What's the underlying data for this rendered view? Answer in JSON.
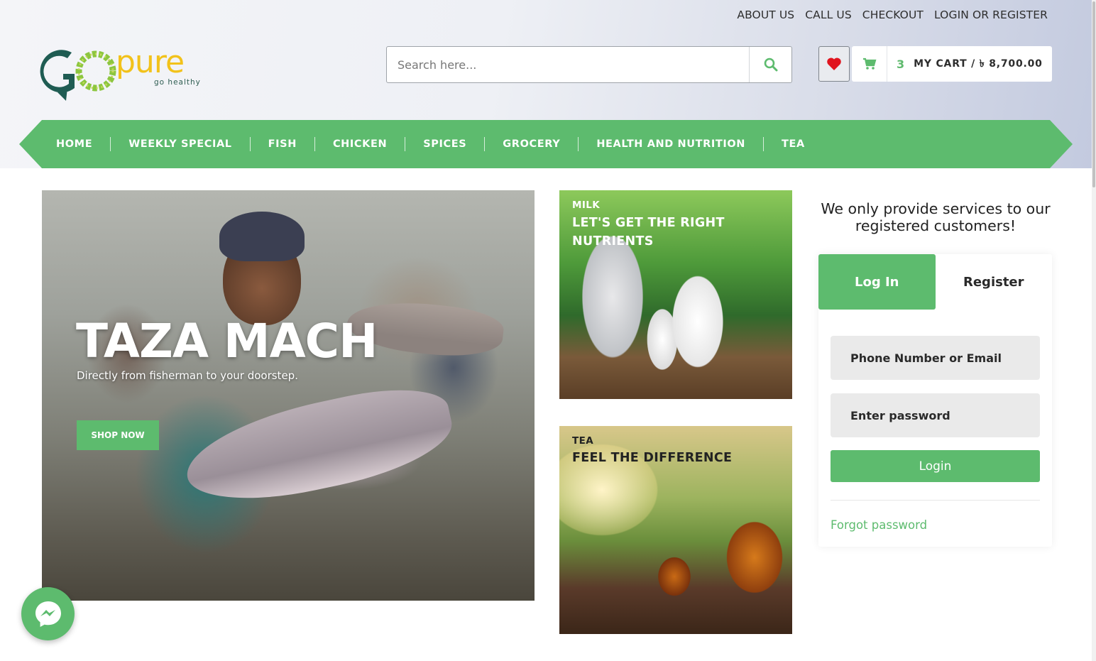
{
  "top_links": [
    "ABOUT US",
    "CALL US",
    "CHECKOUT",
    "LOGIN OR REGISTER"
  ],
  "logo": {
    "pure": "pure",
    "tagline": "go healthy"
  },
  "search": {
    "placeholder": "Search here...",
    "icon": "search-icon"
  },
  "wishlist": {
    "icon": "heart-icon"
  },
  "cart": {
    "icon": "cart-icon",
    "count": "3",
    "label": "MY CART / ৳ 8,700.00"
  },
  "nav": [
    "HOME",
    "WEEKLY SPECIAL",
    "FISH",
    "CHICKEN",
    "SPICES",
    "GROCERY",
    "HEALTH AND NUTRITION",
    "TEA"
  ],
  "hero": {
    "title": "TAZA MACH",
    "subtitle": "Directly from fisherman to your doorstep.",
    "cta": "SHOP NOW"
  },
  "promos": [
    {
      "kicker": "MILK",
      "headline": "LET'S GET THE RIGHT NUTRIENTS"
    },
    {
      "kicker": "TEA",
      "headline": "FEEL THE DIFFERENCE"
    }
  ],
  "auth": {
    "notice": "We only provide services to our registered customers!",
    "tab_login": "Log In",
    "tab_register": "Register",
    "identity_placeholder": "Phone Number or Email",
    "password_placeholder": "Enter password",
    "login_button": "Login",
    "forgot": "Forgot password"
  },
  "messenger": {
    "icon": "messenger-icon"
  },
  "colors": {
    "brand_green": "#5dbb6e",
    "logo_teal": "#1f5c53",
    "logo_yellow": "#f2c21b"
  }
}
